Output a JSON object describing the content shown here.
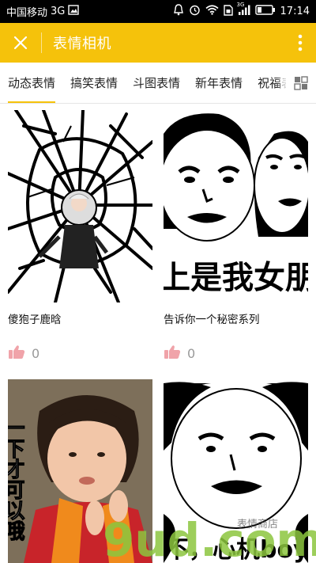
{
  "status_bar": {
    "carrier": "中国移动",
    "network": "3G",
    "signal_label": "3G",
    "time": "17:14"
  },
  "app_bar": {
    "title": "表情相机",
    "close_icon": "close-icon",
    "more_icon": "more-vertical-icon",
    "color": "#f5c20b"
  },
  "tabs": {
    "items": [
      {
        "label": "动态表情",
        "active": true
      },
      {
        "label": "搞笑表情",
        "active": false
      },
      {
        "label": "斗图表情",
        "active": false
      },
      {
        "label": "新年表情",
        "active": false
      },
      {
        "label": "祝福表情",
        "active": false
      }
    ],
    "grid_icon": "grid-icon"
  },
  "cards": [
    {
      "caption": "傻狍子鹿晗",
      "likes": "0"
    },
    {
      "caption": "告诉你一个秘密系列",
      "likes": "0",
      "image_text": "上是我女朋"
    },
    {
      "caption": "",
      "likes": "",
      "image_text": "一下才可以哦"
    },
    {
      "caption": "",
      "likes": "",
      "image_text": "不，心机boy"
    }
  ],
  "watermark": {
    "text": "9ud.com",
    "sub": "表情商店"
  }
}
